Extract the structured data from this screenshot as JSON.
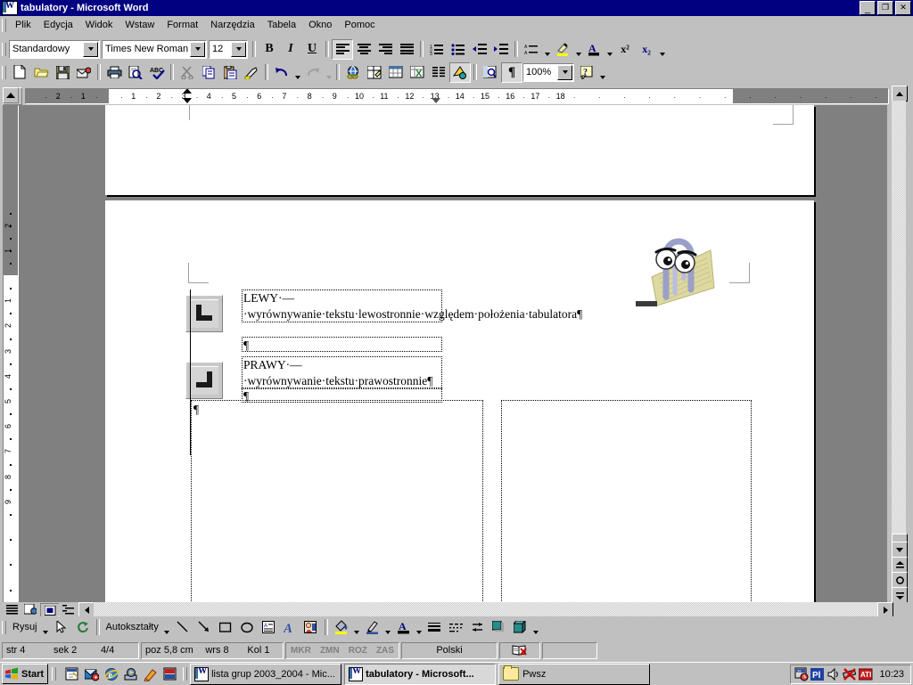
{
  "window": {
    "title": "tabulatory - Microsoft Word",
    "icon": "word-document-icon",
    "minimize": "_",
    "maximize": "❐",
    "close": "✕"
  },
  "menu": {
    "items": [
      {
        "label": "Plik"
      },
      {
        "label": "Edycja"
      },
      {
        "label": "Widok"
      },
      {
        "label": "Wstaw"
      },
      {
        "label": "Format"
      },
      {
        "label": "Narzędzia"
      },
      {
        "label": "Tabela"
      },
      {
        "label": "Okno"
      },
      {
        "label": "Pomoc"
      }
    ]
  },
  "formatting_toolbar": {
    "style": {
      "value": "Standardowy",
      "name": "style-combo"
    },
    "font": {
      "value": "Times New Roman",
      "name": "font-combo"
    },
    "size": {
      "value": "12",
      "name": "font-size-combo"
    },
    "bold": "B",
    "italic": "I",
    "underline": "U",
    "align_left": "align-left",
    "align_center": "align-center",
    "align_right": "align-right",
    "align_justify": "align-justify",
    "numbering": "numbered-list",
    "bullets": "bulleted-list",
    "decrease_indent": "decrease-indent",
    "increase_indent": "increase-indent",
    "borders": "borders",
    "highlight": "highlight",
    "font_color": "font-color",
    "superscript": "x²",
    "subscript": "x₂",
    "overflow": "more-buttons"
  },
  "standard_toolbar": {
    "new": "new-document",
    "open": "open",
    "save": "save",
    "mail": "email",
    "print": "print",
    "preview": "print-preview",
    "spelling": "spelling-grammar",
    "cut": "cut",
    "copy": "copy",
    "paste": "paste",
    "format_painter": "format-painter",
    "undo": "undo",
    "redo": "redo",
    "hyperlink": "insert-hyperlink",
    "tables_borders": "tables-and-borders",
    "insert_table": "insert-table",
    "insert_excel": "insert-excel-worksheet",
    "columns": "columns",
    "drawing": "drawing",
    "document_map": "document-map",
    "show_marks": "show-formatting-marks",
    "zoom": {
      "value": "100%",
      "name": "zoom-combo"
    },
    "help": "office-assistant-help"
  },
  "ruler": {
    "tab_selector": "left-tab-stop",
    "left_numbers": [
      "2",
      "1"
    ],
    "numbers": [
      "1",
      "2",
      "3",
      "4",
      "5",
      "6",
      "7",
      "8",
      "9",
      "10",
      "11",
      "12",
      "13",
      "14",
      "15",
      "16",
      "17",
      "18"
    ],
    "vertical_left_numbers": [
      "2",
      "1"
    ],
    "vertical_numbers": [
      "1",
      "2",
      "3",
      "4",
      "5",
      "6",
      "7",
      "8",
      "9"
    ]
  },
  "document": {
    "paragraphs": [
      {
        "id": "left-tab-paragraph",
        "tab_icon": "left-tab-icon",
        "lines": [
          "LEWY·—·wyrównywanie·tekstu·",
          "lewostronnie·względem·położenia·",
          "tabulatora¶"
        ],
        "text_plain": "LEWY — wyrównywanie tekstu lewostronnie względem położenia tabulatora"
      },
      {
        "id": "empty-paragraph-1",
        "lines": [
          "¶"
        ]
      },
      {
        "id": "right-tab-paragraph",
        "tab_icon": "right-tab-icon",
        "lines": [
          "PRAWY·—·wyrównywanie·tekstu·",
          "prawostronnie¶"
        ],
        "text_plain": "PRAWY — wyrównywanie tekstu prawostronnie"
      },
      {
        "id": "empty-paragraph-2",
        "lines": [
          "¶"
        ]
      },
      {
        "id": "empty-paragraph-3",
        "lines": [
          "¶"
        ]
      }
    ],
    "assistant": "clippy-office-assistant"
  },
  "view_buttons": {
    "normal": "normal-view",
    "web": "web-layout-view",
    "print": "print-layout-view",
    "outline": "outline-view",
    "active": "print-layout-view"
  },
  "drawing_toolbar": {
    "draw_label": "Rysuj",
    "select": "select-objects",
    "free_rotate": "free-rotate",
    "autoshapes_label": "Autokształty",
    "line": "line",
    "arrow": "arrow",
    "rectangle": "rectangle",
    "oval": "oval",
    "textbox": "text-box",
    "wordart": "insert-wordart",
    "clipart": "insert-clip-art",
    "fill_color": "fill-color",
    "line_color": "line-color",
    "font_color": "font-color",
    "line_style": "line-style",
    "dash_style": "dash-style",
    "arrow_style": "arrow-style",
    "shadow": "shadow",
    "three_d": "3-d"
  },
  "status_bar": {
    "page_label": "str",
    "page_value": "4",
    "section_label": "sek",
    "section_value": "2",
    "pages": "4/4",
    "at_label": "poz",
    "at_value": "5,8 cm",
    "line_label": "wrs",
    "line_value": "8",
    "col_label": "Kol",
    "col_value": "1",
    "indicators": [
      "MKR",
      "ZMN",
      "ROZ",
      "ZAS"
    ],
    "language": "Polski",
    "spell_icon": "spelling-status-icon"
  },
  "taskbar": {
    "start": "Start",
    "quick_launch": [
      "show-desktop-icon",
      "outlook-express-icon",
      "internet-explorer-icon",
      "media-player-icon",
      "paint-icon",
      "channels-icon"
    ],
    "tasks": [
      {
        "label": "lista grup 2003_2004 - Mic...",
        "icon": "word-document-icon",
        "active": false
      },
      {
        "label": "tabulatory - Microsoft...",
        "icon": "word-document-icon",
        "active": true
      },
      {
        "label": "Pwsz",
        "icon": "folder-icon",
        "active": false
      }
    ],
    "tray": [
      "clock-scheduler-icon",
      "language-indicator-pl",
      "volume-icon",
      "network-disconnected-icon",
      "ati-icon"
    ],
    "language_badge": "Pl",
    "clock": "10:23"
  },
  "colors": {
    "title_bar": "#000080",
    "face": "#c0c0c0",
    "desktop": "#808080",
    "page": "#ffffff",
    "text": "#000000"
  }
}
